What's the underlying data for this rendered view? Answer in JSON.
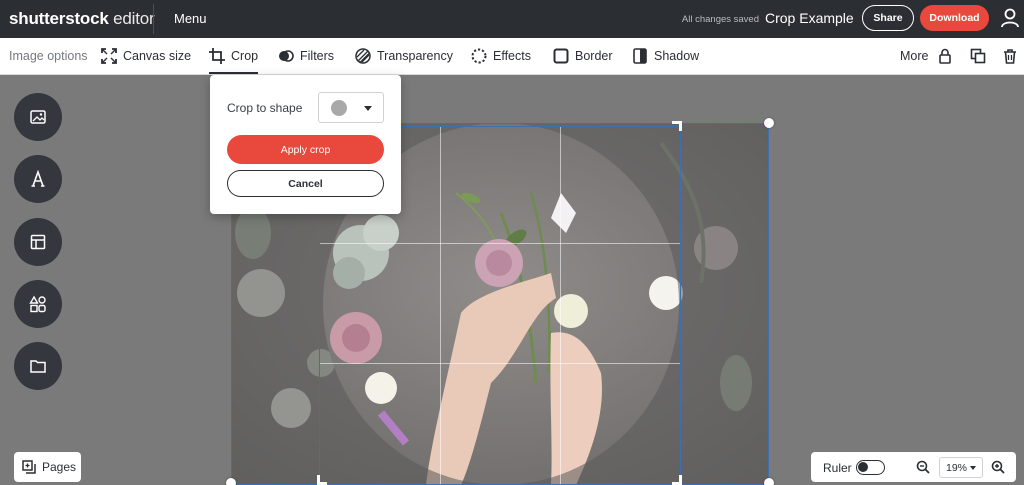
{
  "app": {
    "brand": "shutterstock",
    "product": "editor",
    "menu_label": "Menu",
    "save_status": "All changes saved",
    "document_title": "Crop Example",
    "share_label": "Share",
    "download_label": "Download",
    "accent_color": "#e8493c",
    "user_icon": "user-icon"
  },
  "toolbar": {
    "image_options_label": "Image options",
    "items": [
      {
        "label": "Canvas size",
        "icon": "resize-icon"
      },
      {
        "label": "Crop",
        "icon": "crop-icon",
        "active": true
      },
      {
        "label": "Filters",
        "icon": "filters-icon"
      },
      {
        "label": "Transparency",
        "icon": "transparency-icon"
      },
      {
        "label": "Effects",
        "icon": "effects-icon"
      },
      {
        "label": "Border",
        "icon": "border-icon"
      },
      {
        "label": "Shadow",
        "icon": "shadow-icon"
      }
    ],
    "more_label": "More",
    "right_icons": [
      "lock-icon",
      "duplicate-icon",
      "trash-icon"
    ]
  },
  "sidebar": {
    "items": [
      "image-icon",
      "text-icon",
      "template-icon",
      "elements-icon",
      "folder-icon"
    ]
  },
  "crop_popup": {
    "shape_label": "Crop to shape",
    "selected_shape": "circle",
    "apply_label": "Apply crop",
    "cancel_label": "Cancel"
  },
  "bottom": {
    "pages_label": "Pages",
    "ruler_label": "Ruler",
    "ruler_on": false,
    "zoom_value": "19%"
  }
}
